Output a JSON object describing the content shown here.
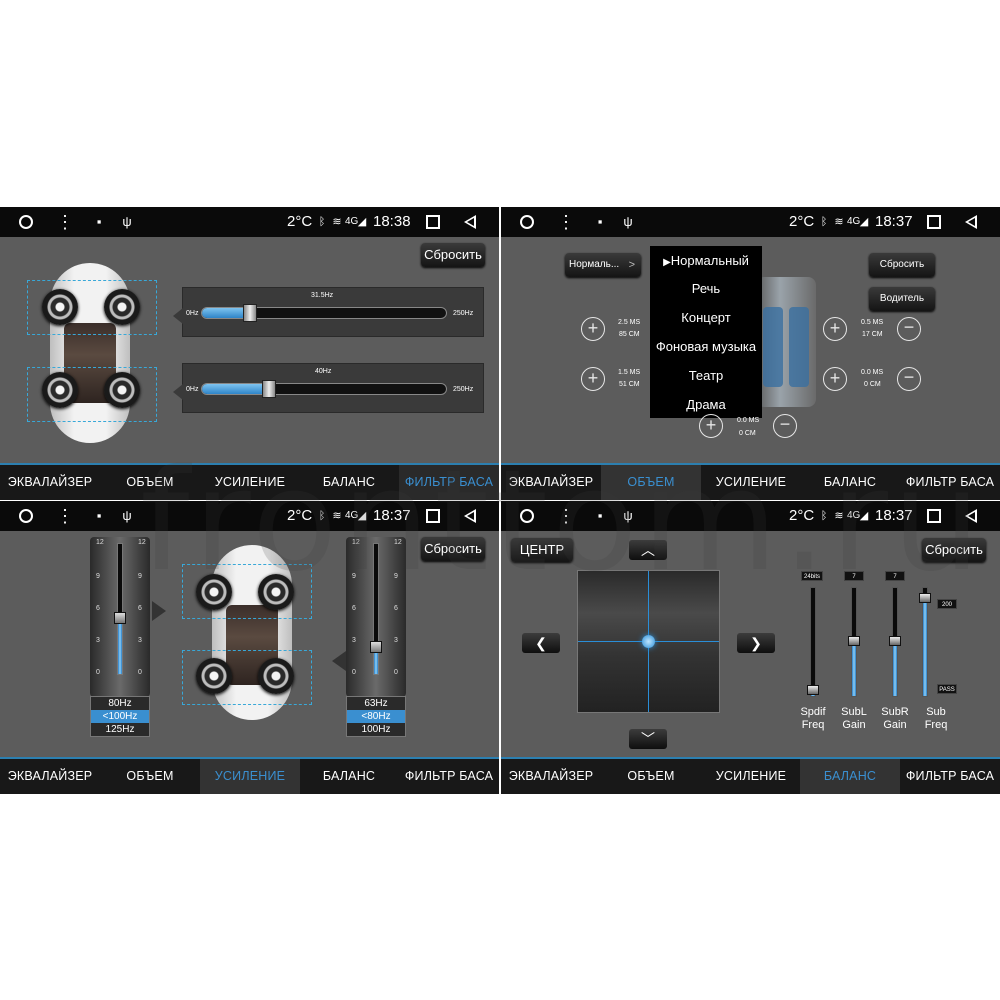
{
  "colors": {
    "accent": "#3a8fd0",
    "background": "#5c5c5c",
    "dashed": "#38a8d8"
  },
  "panels": [
    {
      "status": {
        "temp": "2°C",
        "time": "18:38",
        "net": "4G"
      },
      "reset_label": "Сбросить",
      "sliders": [
        {
          "label": "31.5Hz",
          "min": "0Hz",
          "max": "250Hz",
          "value_fraction": 0.2
        },
        {
          "label": "40Hz",
          "min": "0Hz",
          "max": "250Hz",
          "value_fraction": 0.28
        }
      ],
      "tabs": [
        "ЭКВАЛАЙЗЕР",
        "ОБЪЕМ",
        "УСИЛЕНИЕ",
        "БАЛАНС",
        "ФИЛЬТР БАСА"
      ],
      "active_tab": "ФИЛЬТР БАСА"
    },
    {
      "status": {
        "temp": "2°C",
        "time": "18:37",
        "net": "4G"
      },
      "preset_label": "Нормаль...",
      "preset_arrow": ">",
      "menu": [
        "Нормальный",
        "Речь",
        "Концерт",
        "Фоновая музыка",
        "Театр",
        "Драма"
      ],
      "reset_label": "Сбросить",
      "driver_label": "Водитель",
      "delays": [
        {
          "ms": "2.5 MS",
          "cm": "85 CM"
        },
        {
          "ms": "1.5 MS",
          "cm": "51 CM"
        },
        {
          "ms": "0.5 MS",
          "cm": "17 CM"
        },
        {
          "ms": "0.0 MS",
          "cm": "0 CM"
        },
        {
          "ms": "0.0 MS",
          "cm": "0 CM"
        }
      ],
      "tabs": [
        "ЭКВАЛАЙЗЕР",
        "ОБЪЕМ",
        "УСИЛЕНИЕ",
        "БАЛАНС",
        "ФИЛЬТР БАСА"
      ],
      "active_tab": "ОБЪЕМ"
    },
    {
      "status": {
        "temp": "2°C",
        "time": "18:37",
        "net": "4G"
      },
      "reset_label": "Сбросить",
      "scale": [
        "12",
        "9",
        "6",
        "3",
        "0"
      ],
      "left_freqs": [
        "80Hz",
        "<100Hz",
        "125Hz"
      ],
      "right_freqs": [
        "63Hz",
        "<80Hz",
        "100Hz"
      ],
      "left_level_fraction": 0.42,
      "right_level_fraction": 0.2,
      "tabs": [
        "ЭКВАЛАЙЗЕР",
        "ОБЪЕМ",
        "УСИЛЕНИЕ",
        "БАЛАНС",
        "ФИЛЬТР БАСА"
      ],
      "active_tab": "УСИЛЕНИЕ"
    },
    {
      "status": {
        "temp": "2°C",
        "time": "18:37",
        "net": "4G"
      },
      "center_label": "ЦЕНТР",
      "reset_label": "Сбросить",
      "mixers": [
        {
          "badge": "24bits",
          "label1": "Spdif",
          "label2": "Freq",
          "level_fraction": 0.05
        },
        {
          "badge": "7",
          "label1": "SubL",
          "label2": "Gain",
          "level_fraction": 0.5
        },
        {
          "badge": "7",
          "label1": "SubR",
          "label2": "Gain",
          "level_fraction": 0.5
        },
        {
          "badge_top": "200",
          "badge_bottom": "PASS",
          "label1": "Sub",
          "label2": "Freq",
          "level_fraction": 0.9
        }
      ],
      "tabs": [
        "ЭКВАЛАЙЗЕР",
        "ОБЪЕМ",
        "УСИЛЕНИЕ",
        "БАЛАНС",
        "ФИЛЬТР БАСА"
      ],
      "active_tab": "БАЛАНС"
    }
  ],
  "watermark": "fronttom.ru"
}
